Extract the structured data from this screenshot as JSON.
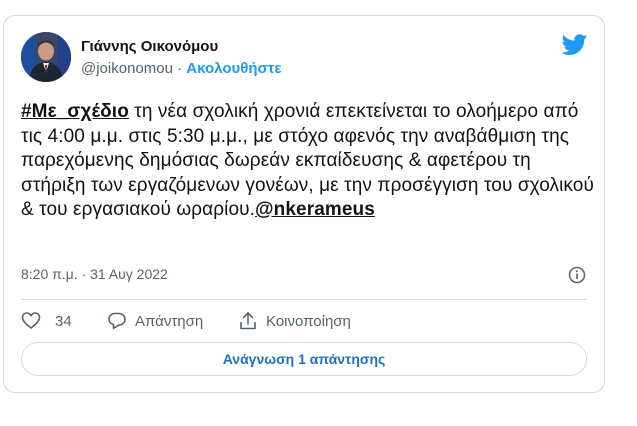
{
  "author": {
    "name": "Γιάννης Οικονόμου",
    "handle": "@joikonomou",
    "separator": "·",
    "follow_label": "Ακολουθήστε"
  },
  "tweet": {
    "hashtag": "#Με_σχέδιο",
    "body": " τη νέα σχολική χρονιά επεκτείνεται το ολοήμερο από τις 4:00 μ.μ. στις 5:30 μ.μ., με στόχο αφενός την αναβάθμιση της παρεχόμενης δημόσιας δωρεάν εκπαίδευσης & αφετέρου τη στήριξη των εργαζόμενων γονέων, με την προσέγγιση του σχολικού & του εργασιακού ωραρίου.",
    "mention": "@nkerameus",
    "timestamp": "8:20 π.μ. · 31 Αυγ 2022"
  },
  "actions": {
    "like_count": "34",
    "reply_label": "Απάντηση",
    "share_label": "Κοινοποίηση"
  },
  "read_replies_label": "Ανάγνωση 1 απάντησης",
  "colors": {
    "accent": "#1d9bf0",
    "button_text": "#1d6fc2",
    "muted": "#536471",
    "border": "#cfd9de"
  },
  "icons": [
    "twitter-bird-icon",
    "info-icon",
    "heart-icon",
    "comment-icon",
    "share-icon"
  ]
}
